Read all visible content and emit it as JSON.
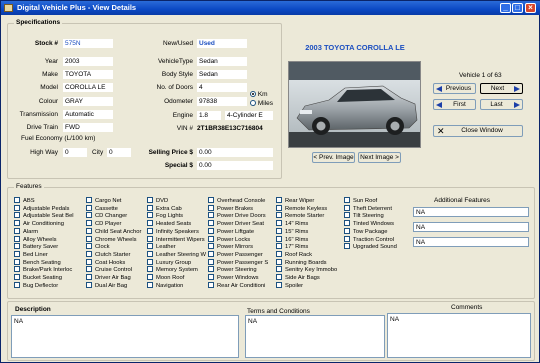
{
  "window": {
    "title": "Digital Vehicle Plus - View Details",
    "minimize": "_",
    "maximize": "□",
    "close": "×"
  },
  "specs": {
    "group_title": "Specifications",
    "stock_label": "Stock #",
    "stock": "575N",
    "new_used_label": "New/Used",
    "new_used": "Used",
    "year_label": "Year",
    "year": "2003",
    "vehicle_type_label": "VehicleType",
    "vehicle_type": "Sedan",
    "make_label": "Make",
    "make": "TOYOTA",
    "body_style_label": "Body Style",
    "body_style": "Sedan",
    "model_label": "Model",
    "model": "COROLLA LE",
    "doors_label": "No. of Doors",
    "doors": "4",
    "colour_label": "Colour",
    "colour": "GRAY",
    "odometer_label": "Odometer",
    "odometer": "97838",
    "unit_km": "Km",
    "unit_miles": "Miles",
    "unit_selected": "Km",
    "transmission_label": "Transmission",
    "transmission": "Automatic",
    "engine_label": "Engine",
    "engine": "1.8",
    "engine_type": "4-Cylinder E",
    "drive_label": "Drive Train",
    "drive": "FWD",
    "vin_label": "VIN #",
    "vin": "2T1BR38E13C716804",
    "fuel_label": "Fuel Economy (L/100 km)",
    "highway_label": "High Way",
    "highway": "0",
    "city_label": "City",
    "city": "0",
    "selling_label": "Selling Price $",
    "selling": "0.00",
    "special_label": "Special $",
    "special": "0.00"
  },
  "photo": {
    "heading": "2003 TOYOTA COROLLA LE",
    "prev": "< Prev. Image",
    "next": "Next Image >"
  },
  "nav": {
    "counter": "Vehicle 1 of 63",
    "previous": "Previous",
    "next": "Next",
    "first": "First",
    "last": "Last",
    "close": "Close Window"
  },
  "features": {
    "group_title": "Features",
    "additional_title": "Additional Features",
    "additional": [
      "NA",
      "NA",
      "NA"
    ],
    "columns": [
      [
        "ABS",
        "Adjustable Pedals",
        "Adjustable Seat Bel",
        "Air Conditioning",
        "Alarm",
        "Alloy Wheels",
        "Battery Saver",
        "Bed Liner",
        "Bench Seating",
        "Brake/Park Interloc",
        "Bucket Seating",
        "Bug Deflector"
      ],
      [
        "Cargo Net",
        "Cassette",
        "CD Changer",
        "CD Player",
        "Child Seat Anchor",
        "Chrome Wheels",
        "Clock",
        "Clutch Starter",
        "Coat Hooks",
        "Cruise Control",
        "Driver Air Bag",
        "Dual Air Bag"
      ],
      [
        "DVD",
        "Extra Cab",
        "Fog Lights",
        "Heated Seats",
        "Infinity Speakers",
        "Intermittent Wipers",
        "Leather",
        "Leather Steering W",
        "Luxury Group",
        "Memory System",
        "Moon Roof",
        "Navigation"
      ],
      [
        "Overhead Console",
        "Power Brakes",
        "Power Drive Doors",
        "Power Driver Seat",
        "Power Liftgate",
        "Power Locks",
        "Power Mirrors",
        "Power Passenger",
        "Power Passenger S",
        "Power Steering",
        "Power Windows",
        "Rear Air Conditioni"
      ],
      [
        "Rear Wiper",
        "Remote Keyless",
        "Remote Starter",
        "14\" Rims",
        "15\" Rims",
        "16\" Rims",
        "17\" Rims",
        "Roof Rack",
        "Running Boards",
        "Senitry Key Immobo",
        "Side Air Bags",
        "Spoiler"
      ],
      [
        "Sun Roof",
        "Theft Deterrent",
        "Tilt Steering",
        "Tinted Windows",
        "Tow Package",
        "Traction Control",
        "Upgraded Sound"
      ]
    ]
  },
  "bottom": {
    "description_label": "Description",
    "description": "NA",
    "terms_label": "Terms and Conditions",
    "terms": "NA",
    "comments_label": "Comments",
    "comments": "NA"
  }
}
